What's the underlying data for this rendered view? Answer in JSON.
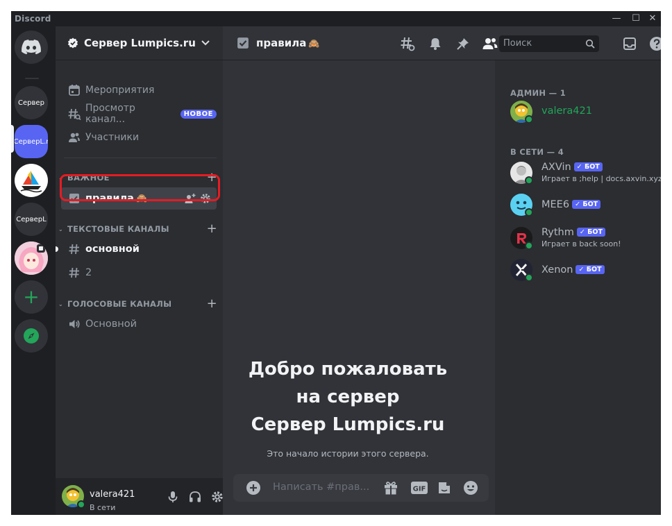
{
  "window": {
    "title": "Discord",
    "controls": {
      "minimize": "—",
      "maximize": "☐",
      "close": "✕"
    }
  },
  "guilds": [
    {
      "label": "",
      "type": "home"
    },
    {
      "label": "Сервер"
    },
    {
      "label": "СерверL.r",
      "active": true
    },
    {
      "label": "",
      "type": "sailboat"
    },
    {
      "label": "СерверL"
    },
    {
      "label": "",
      "type": "anime"
    },
    {
      "label": "+",
      "type": "add"
    },
    {
      "label": "",
      "type": "explore"
    }
  ],
  "sidebar": {
    "server_name": "Сервер Lumpics.ru",
    "nav": [
      {
        "label": "Мероприятия",
        "icon": "calendar-icon"
      },
      {
        "label": "Просмотр канал...",
        "icon": "browse-channels-icon",
        "badge": "НОВОЕ"
      },
      {
        "label": "Участники",
        "icon": "members-icon"
      }
    ],
    "categories": [
      {
        "name": "ВАЖНОЕ",
        "channels": [
          {
            "name": "правила",
            "emoji": "🙈",
            "icon": "rules-icon",
            "selected": true
          }
        ]
      },
      {
        "name": "ТЕКСТОВЫЕ КАНАЛЫ",
        "channels": [
          {
            "name": "основной",
            "icon": "hash-icon",
            "unread": true
          },
          {
            "name": "2",
            "icon": "hash-icon"
          }
        ]
      },
      {
        "name": "ГОЛОСОВЫЕ КАНАЛЫ",
        "channels": [
          {
            "name": "Основной",
            "icon": "speaker-icon"
          }
        ]
      }
    ]
  },
  "user_panel": {
    "username": "valera421",
    "status": "В сети"
  },
  "header": {
    "channel_name": "правила",
    "channel_emoji": "🙈",
    "search_placeholder": "Поиск"
  },
  "main": {
    "welcome_line1": "Добро пожаловать",
    "welcome_line2": "на сервер",
    "welcome_line3": "Сервер Lumpics.ru",
    "welcome_sub": "Это начало истории этого сервера.",
    "composer_placeholder": "Написать #прав..."
  },
  "members": {
    "groups": [
      {
        "title": "АДМИН — 1",
        "members": [
          {
            "name": "valera421",
            "role": "admin"
          }
        ]
      },
      {
        "title": "В СЕТИ — 4",
        "members": [
          {
            "name": "AXVin",
            "bot": "БОТ",
            "activity": "Играет в ;help | docs.axvin.xyz"
          },
          {
            "name": "MEE6",
            "bot": "БОТ",
            "activity": ""
          },
          {
            "name": "Rythm",
            "bot": "БОТ",
            "activity": "Играет в back soon!"
          },
          {
            "name": "Xenon",
            "bot": "БОТ",
            "activity": ""
          }
        ]
      }
    ],
    "bot_check": "✓"
  },
  "colors": {
    "blurple": "#5865f2",
    "online": "#23a55a",
    "highlight": "#e51c23"
  }
}
